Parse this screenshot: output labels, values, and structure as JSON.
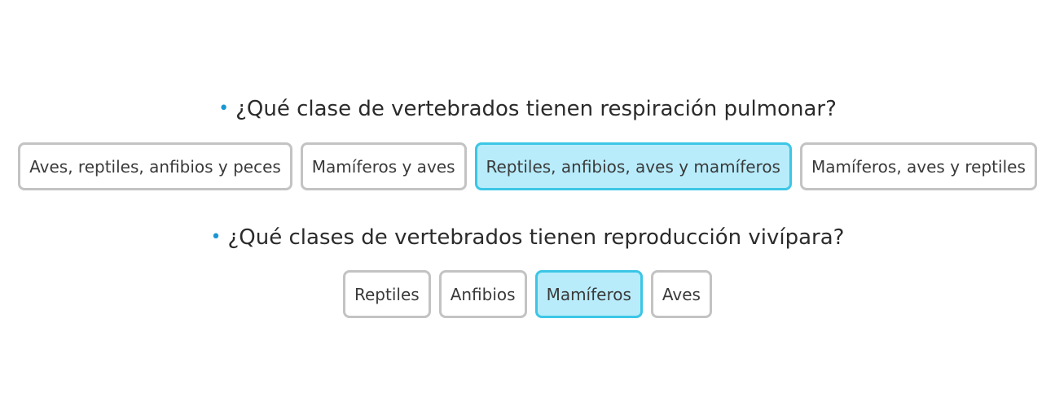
{
  "questions": [
    {
      "text": "¿Qué clase de vertebrados tienen respiración pulmonar?",
      "options": [
        {
          "label": "Aves, reptiles, anfibios y peces",
          "selected": false
        },
        {
          "label": "Mamíferos y aves",
          "selected": false
        },
        {
          "label": "Reptiles, anfibios, aves y mamíferos",
          "selected": true
        },
        {
          "label": "Mamíferos, aves y reptiles",
          "selected": false
        }
      ]
    },
    {
      "text": "¿Qué clases de vertebrados tienen reproducción vivípara?",
      "options": [
        {
          "label": "Reptiles",
          "selected": false
        },
        {
          "label": "Anfibios",
          "selected": false
        },
        {
          "label": "Mamíferos",
          "selected": true
        },
        {
          "label": "Aves",
          "selected": false
        }
      ]
    }
  ],
  "bullet": "•",
  "colors": {
    "bullet": "#1a96d4",
    "option_border": "#c3c3c3",
    "selected_bg": "#b8ecfb",
    "selected_border": "#3cc6e6"
  }
}
